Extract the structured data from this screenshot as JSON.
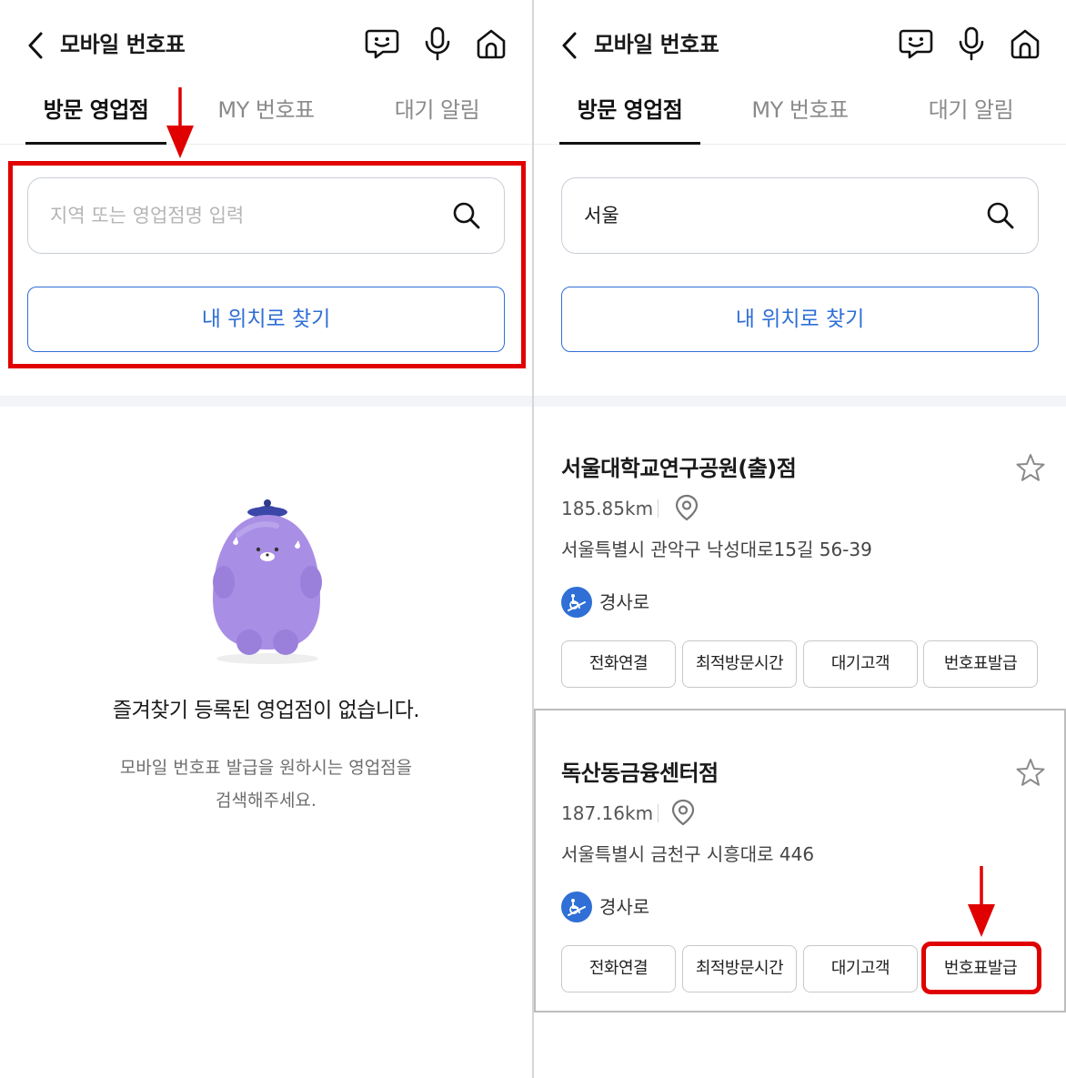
{
  "left": {
    "header": {
      "title": "모바일 번호표"
    },
    "tabs": [
      "방문 영업점",
      "MY 번호표",
      "대기 알림"
    ],
    "search": {
      "placeholder": "지역 또는 영업점명 입력",
      "value": ""
    },
    "locate_label": "내 위치로 찾기",
    "empty_state": {
      "title": "즐겨찾기 등록된 영업점이 없습니다.",
      "desc_line1": "모바일 번호표 발급을 원하시는 영업점을",
      "desc_line2": "검색해주세요."
    }
  },
  "right": {
    "header": {
      "title": "모바일 번호표"
    },
    "tabs": [
      "방문 영업점",
      "MY 번호표",
      "대기 알림"
    ],
    "search": {
      "value": "서울"
    },
    "locate_label": "내 위치로 찾기",
    "branches": [
      {
        "name": "서울대학교연구공원(출)점",
        "distance": "185.85km",
        "address": "서울특별시 관악구 낙성대로15길 56-39",
        "feature": "경사로",
        "actions": [
          "전화연결",
          "최적방문시간",
          "대기고객",
          "번호표발급"
        ]
      },
      {
        "name": "독산동금융센터점",
        "distance": "187.16km",
        "address": "서울특별시 금천구 시흥대로 446",
        "feature": "경사로",
        "actions": [
          "전화연결",
          "최적방문시간",
          "대기고객",
          "번호표발급"
        ]
      }
    ]
  },
  "colors": {
    "accent": "#2f6fd6",
    "annotation": "#e00000",
    "mascot": "#a98ee6"
  },
  "icons": [
    "back-arrow-icon",
    "chatbot-icon",
    "microphone-icon",
    "home-icon",
    "search-icon",
    "star-icon",
    "location-pin-icon",
    "ramp-icon"
  ]
}
